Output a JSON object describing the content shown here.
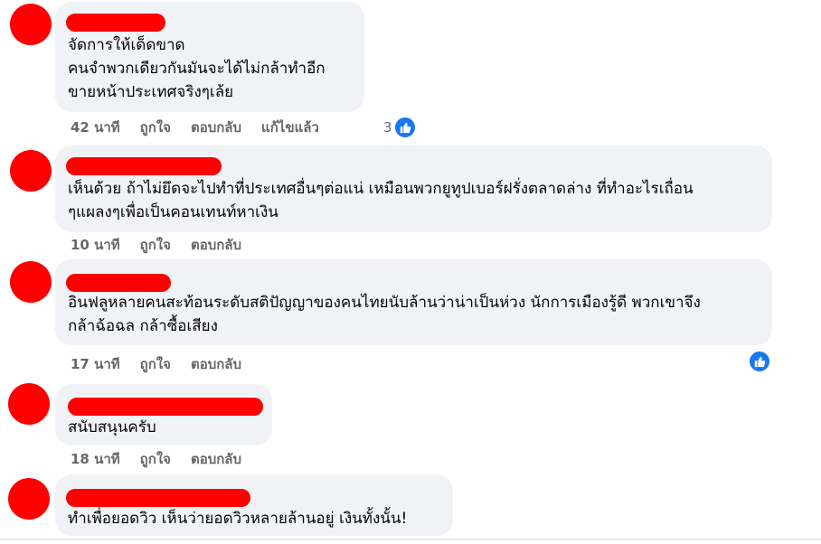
{
  "comments": [
    {
      "lines": [
        "จัดการให้เด็ดขาด",
        "คนจำพวกเดียวกันมันจะได้ไม่กล้าทำอีก",
        "ขายหน้าประเทศจริงๆเล้ย"
      ],
      "time": "42 นาที",
      "like_label": "ถูกใจ",
      "reply_label": "ตอบกลับ",
      "edited_label": "แก้ไขแล้ว",
      "reaction_count": "3"
    },
    {
      "lines": [
        "เห็นด้วย ถ้าไม่ยึดจะไปทำที่ประเทศอื่นๆต่อแน่ เหมือนพวกยูทูปเบอร์ฝรั่งตลาดล่าง ที่ทำอะไรเถื่อน",
        "ๆแผลงๆเพื่อเป็นคอนเทนท์หาเงิน"
      ],
      "time": "10 นาที",
      "like_label": "ถูกใจ",
      "reply_label": "ตอบกลับ"
    },
    {
      "lines": [
        "อินฟลูหลายคนสะท้อนระดับสติปัญญาของคนไทยนับล้านว่าน่าเป็นห่วง นักการเมืองรู้ดี พวกเขาจึง",
        "กล้าฉ้อฉล กล้าซื้อเสียง"
      ],
      "time": "17 นาที",
      "like_label": "ถูกใจ",
      "reply_label": "ตอบกลับ"
    },
    {
      "lines": [
        "สนับสนุนครับ"
      ],
      "time": "18 นาที",
      "like_label": "ถูกใจ",
      "reply_label": "ตอบกลับ"
    },
    {
      "lines": [
        "ทำเพื่อยอดวิว เห็นว่ายอดวิวหลายล้านอยู่ เงินทั้งนั้น!"
      ]
    }
  ],
  "colors": {
    "redaction": "#ff0000",
    "bubble": "#f0f2f5",
    "meta_text": "#65676b",
    "like_blue": "#1877f2"
  },
  "icons": {
    "like": "thumbs-up-icon"
  }
}
